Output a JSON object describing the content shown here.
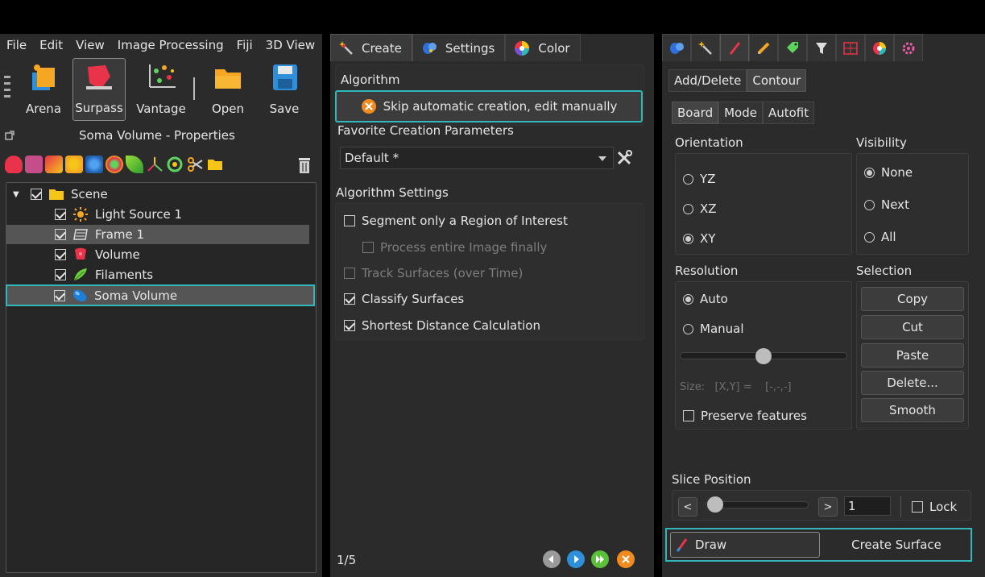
{
  "left_panel": {
    "menu": [
      "File",
      "Edit",
      "View",
      "Image Processing",
      "Fiji",
      "3D View"
    ],
    "toolbar": {
      "arena": "Arena",
      "surpass": "Surpass",
      "vantage": "Vantage",
      "open": "Open",
      "save": "Save"
    },
    "properties_title": "Soma Volume - Properties",
    "tree": {
      "scene": "Scene",
      "light_source": "Light Source 1",
      "frame": "Frame 1",
      "volume": "Volume",
      "filaments": "Filaments",
      "soma_volume": "Soma Volume"
    }
  },
  "middle_panel": {
    "tabs": {
      "create": "Create",
      "settings": "Settings",
      "color": "Color"
    },
    "algorithm_label": "Algorithm",
    "skip_button": "Skip automatic creation, edit manually",
    "favorite_label": "Favorite Creation Parameters",
    "favorite_value": "Default *",
    "algorithm_settings_label": "Algorithm Settings",
    "options": {
      "segment_roi": "Segment only a Region of Interest",
      "process_entire": "Process entire Image finally",
      "track_surfaces": "Track Surfaces (over Time)",
      "classify_surfaces": "Classify Surfaces",
      "shortest_distance": "Shortest Distance Calculation"
    },
    "pager": "1/5"
  },
  "right_panel": {
    "mode_tabs": {
      "add_delete": "Add/Delete",
      "contour": "Contour"
    },
    "sub_tabs": {
      "board": "Board",
      "mode": "Mode",
      "autofit": "Autofit"
    },
    "orientation": {
      "label": "Orientation",
      "yz": "YZ",
      "xz": "XZ",
      "xy": "XY"
    },
    "visibility": {
      "label": "Visibility",
      "none": "None",
      "next": "Next",
      "all": "All"
    },
    "resolution": {
      "label": "Resolution",
      "auto": "Auto",
      "manual": "Manual",
      "size": "Size:   [X,Y] =    [-,-,-]",
      "preserve": "Preserve features",
      "slider_level": 0.5
    },
    "selection": {
      "label": "Selection",
      "copy": "Copy",
      "cut": "Cut",
      "paste": "Paste",
      "delete": "Delete...",
      "smooth": "Smooth"
    },
    "slice": {
      "label": "Slice Position",
      "prev": "<",
      "next": ">",
      "value": "1",
      "lock": "Lock"
    },
    "draw": "Draw",
    "create_surface": "Create Surface"
  },
  "colors": {
    "highlight": "#2fb7bb",
    "panel_bg": "#2b2b2b",
    "folder": "#f5c518",
    "volume": "#e8334a",
    "soma": "#1e7fd8"
  }
}
